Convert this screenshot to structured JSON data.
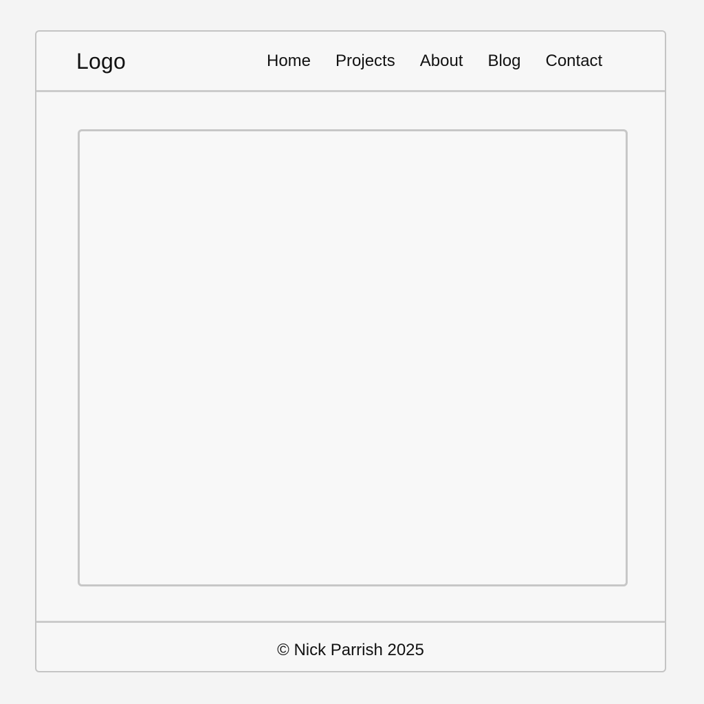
{
  "header": {
    "logo": "Logo",
    "nav": [
      "Home",
      "Projects",
      "About",
      "Blog",
      "Contact"
    ]
  },
  "footer": {
    "copyright": "© Nick Parrish 2025"
  },
  "colors": {
    "background": "#f4f4f4",
    "border": "#c4c4c4",
    "text": "#111111"
  }
}
